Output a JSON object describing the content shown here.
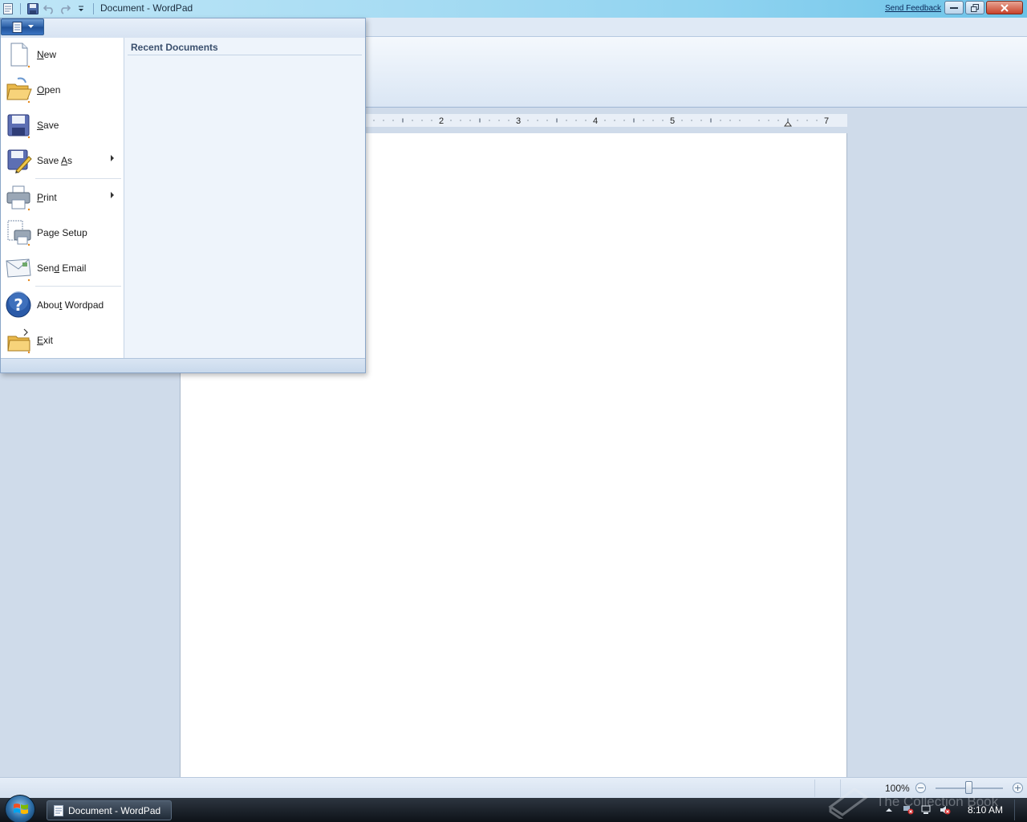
{
  "window": {
    "title": "Document - WordPad",
    "send_feedback": "Send Feedback"
  },
  "ruler": {
    "labels": [
      "2",
      "3",
      "4",
      "5",
      "7"
    ]
  },
  "app_menu": {
    "items": [
      {
        "label_pre": "",
        "label_key": "N",
        "label_post": "ew",
        "icon": "new-document-icon"
      },
      {
        "label_pre": "",
        "label_key": "O",
        "label_post": "pen",
        "icon": "open-folder-icon"
      },
      {
        "label_pre": "",
        "label_key": "S",
        "label_post": "ave",
        "icon": "floppy-disk-icon"
      },
      {
        "label_pre": "Save ",
        "label_key": "A",
        "label_post": "s",
        "icon": "save-as-icon"
      },
      {
        "label_pre": "",
        "label_key": "P",
        "label_post": "rint",
        "icon": "printer-icon"
      },
      {
        "label_pre": "Pa",
        "label_key": "g",
        "label_post": "e Setup",
        "icon": "page-setup-icon"
      },
      {
        "label_pre": "Sen",
        "label_key": "d",
        "label_post": " Email",
        "icon": "send-email-icon"
      },
      {
        "label_pre": "Abou",
        "label_key": "t",
        "label_post": " Wordpad",
        "icon": "help-icon"
      },
      {
        "label_pre": "",
        "label_key": "E",
        "label_post": "xit",
        "icon": "exit-icon"
      }
    ],
    "recent_title": "Recent Documents"
  },
  "status": {
    "zoom": "100%"
  },
  "taskbar": {
    "task_label": "Document - WordPad",
    "clock": "8:10 AM",
    "watermark": "The Collection Book"
  },
  "colors": {
    "accent": "#1f4f95",
    "ribbon": "#dae6f4",
    "taskbar": "#1a222c"
  }
}
